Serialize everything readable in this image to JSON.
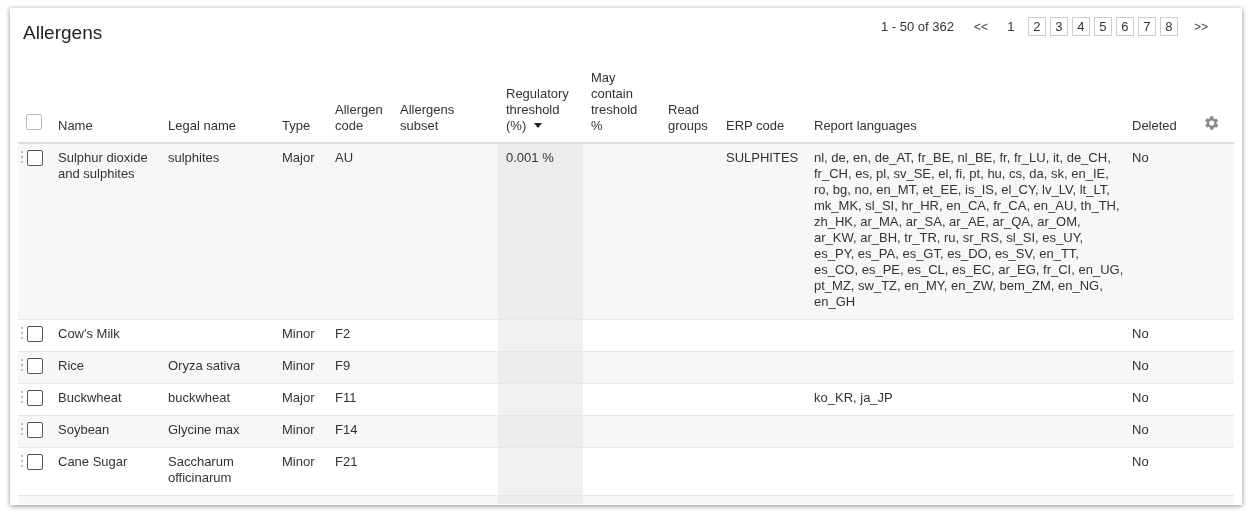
{
  "title": "Allergens",
  "pagination": {
    "range": "1 - 50 of 362",
    "first": "<<",
    "last": ">>",
    "pages": [
      {
        "label": "1",
        "selected": true
      },
      {
        "label": "2",
        "selected": false
      },
      {
        "label": "3",
        "selected": false
      },
      {
        "label": "4",
        "selected": false
      },
      {
        "label": "5",
        "selected": false
      },
      {
        "label": "6",
        "selected": false
      },
      {
        "label": "7",
        "selected": false
      },
      {
        "label": "8",
        "selected": false
      }
    ]
  },
  "table": {
    "select_all": {
      "checked": false
    },
    "columns": [
      {
        "label": "Name",
        "sorted": false
      },
      {
        "label": "Legal name",
        "sorted": false
      },
      {
        "label": "Type",
        "sorted": false
      },
      {
        "label": "Allergen code",
        "sorted": false
      },
      {
        "label": "Allergens subset",
        "sorted": false
      },
      {
        "label": "Regulatory threshold (%)",
        "sorted": true
      },
      {
        "label": "May contain treshold %",
        "sorted": false
      },
      {
        "label": "Read groups",
        "sorted": false
      },
      {
        "label": "ERP code",
        "sorted": false
      },
      {
        "label": "Report languages",
        "sorted": false
      },
      {
        "label": "Deleted",
        "sorted": false
      }
    ],
    "rows": [
      {
        "checked": false,
        "cells": [
          "Sulphur dioxide and sulphites",
          "sulphites",
          "Major",
          "AU",
          "",
          "0.001 %",
          "",
          "",
          "SULPHITES",
          "nl, de, en, de_AT, fr_BE, nl_BE, fr, fr_LU, it, de_CH, fr_CH, es, pl, sv_SE, el, fi, pt, hu, cs, da, sk, en_IE, ro, bg, no, en_MT, et_EE, is_IS, el_CY, lv_LV, lt_LT, mk_MK, sl_SI, hr_HR, en_CA, fr_CA, en_AU, th_TH, zh_HK, ar_MA, ar_SA, ar_AE, ar_QA, ar_OM, ar_KW, ar_BH, tr_TR, ru, sr_RS, sl_SI, es_UY, es_PY, es_PA, es_GT, es_DO, es_SV, en_TT, es_CO, es_PE, es_CL, es_EC, ar_EG, fr_CI, en_UG, pt_MZ, sw_TZ, en_MY, en_ZW, bem_ZM, en_NG, en_GH",
          "No"
        ]
      },
      {
        "checked": false,
        "cells": [
          "Cow's Milk",
          "",
          "Minor",
          "F2",
          "",
          "",
          "",
          "",
          "",
          "",
          "No"
        ]
      },
      {
        "checked": false,
        "cells": [
          "Rice",
          "Oryza sativa",
          "Minor",
          "F9",
          "",
          "",
          "",
          "",
          "",
          "",
          "No"
        ]
      },
      {
        "checked": false,
        "cells": [
          "Buckwheat",
          "buckwheat",
          "Major",
          "F11",
          "",
          "",
          "",
          "",
          "",
          "ko_KR, ja_JP",
          "No"
        ]
      },
      {
        "checked": false,
        "cells": [
          "Soybean",
          "Glycine max",
          "Minor",
          "F14",
          "",
          "",
          "",
          "",
          "",
          "",
          "No"
        ]
      },
      {
        "checked": false,
        "cells": [
          "Cane Sugar",
          "Saccharum officinarum",
          "Minor",
          "F21",
          "",
          "",
          "",
          "",
          "",
          "",
          "No"
        ]
      }
    ]
  }
}
